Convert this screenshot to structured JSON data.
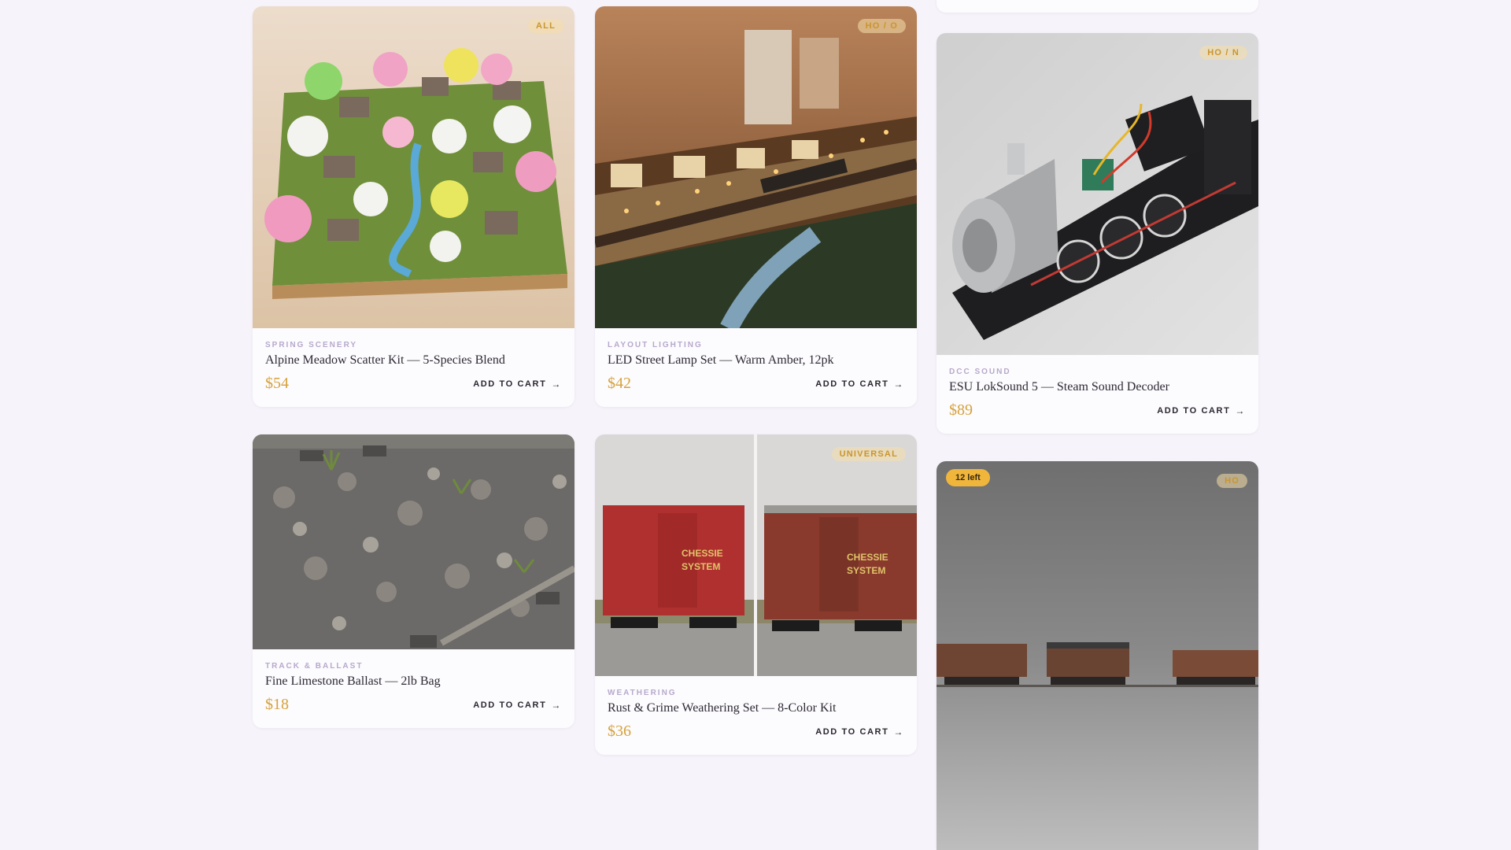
{
  "products": [
    {
      "category": "SPRING SCENERY",
      "name": "Alpine Meadow Scatter Kit — 5-Species Blend",
      "price": "$54",
      "scale": "ALL",
      "cart_label": "ADD TO CART",
      "image": "spring-diorama-image"
    },
    {
      "category": "LAYOUT LIGHTING",
      "name": "LED Street Lamp Set — Warm Amber, 12pk",
      "price": "$42",
      "scale": "HO / O",
      "cart_label": "ADD TO CART",
      "image": "lit-village-layout-image"
    },
    {
      "category": "DCC SOUND",
      "name": "ESU LokSound 5 — Steam Sound Decoder",
      "price": "$89",
      "scale": "HO / N",
      "cart_label": "ADD TO CART",
      "image": "steam-locomotive-image"
    },
    {
      "category": "TRACK & BALLAST",
      "name": "Fine Limestone Ballast — 2lb Bag",
      "price": "$18",
      "scale": "",
      "cart_label": "ADD TO CART",
      "image": "ballast-closeup-image"
    },
    {
      "category": "WEATHERING",
      "name": "Rust & Grime Weathering Set — 8-Color Kit",
      "price": "$36",
      "scale": "UNIVERSAL",
      "cart_label": "ADD TO CART",
      "image": "boxcar-before-after-image"
    },
    {
      "category": "",
      "name": "",
      "price": "",
      "scale": "HO",
      "stock": "12 left",
      "cart_label": "",
      "image": "freight-cars-image"
    }
  ],
  "colors": {
    "page_bg": "#f6f3fa",
    "card_bg": "#fcfbfd",
    "accent_gold": "#d6a23c",
    "category_lilac": "#b7a9cc"
  },
  "icons": {
    "cart_arrow": "→"
  }
}
